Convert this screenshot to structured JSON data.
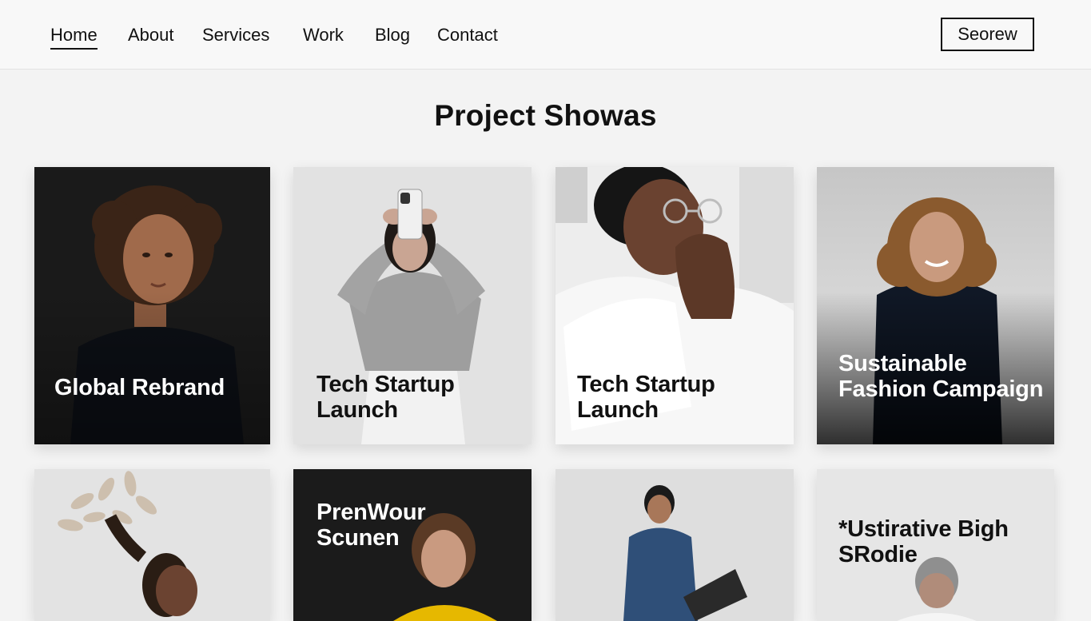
{
  "nav": {
    "items": [
      {
        "label": "Home",
        "active": true
      },
      {
        "label": "About"
      },
      {
        "label": "Services"
      },
      {
        "label": "Work"
      },
      {
        "label": "Blog"
      },
      {
        "label": "Contact"
      }
    ],
    "cta_label": "Seorew"
  },
  "main": {
    "title": "Project Showas",
    "projects": [
      {
        "title": "Global Rebrand",
        "image": "portrait-woman-curly-hair-dark",
        "text_color": "#ffffff"
      },
      {
        "title": "Tech Startup\nLaunch",
        "image": "woman-holding-phone-on-head",
        "text_color": "#111111"
      },
      {
        "title": "Tech Startup\nLaunch",
        "image": "man-with-glasses-thinking",
        "text_color": "#111111"
      },
      {
        "title": "Sustainable\nFashion Campaign",
        "image": "woman-curly-hair-denim-smiling",
        "text_color": "#ffffff"
      },
      {
        "title": "",
        "image": "woman-feather-headdress-profile",
        "text_color": "#111111"
      },
      {
        "title": "PrenWour\nScunen",
        "image": "woman-yellow-top-dark-bg",
        "text_color": "#ffffff"
      },
      {
        "title": "",
        "image": "man-denim-shirt-laptop",
        "text_color": "#111111"
      },
      {
        "title": "*Ustirative Bigh\nSRodie",
        "image": "person-gray-hair-looking-down",
        "text_color": "#111111"
      }
    ]
  },
  "colors": {
    "page_bg": "#f3f3f3",
    "header_bg": "#f8f8f8",
    "text": "#111111",
    "dark_card": "#1c1c1c"
  }
}
